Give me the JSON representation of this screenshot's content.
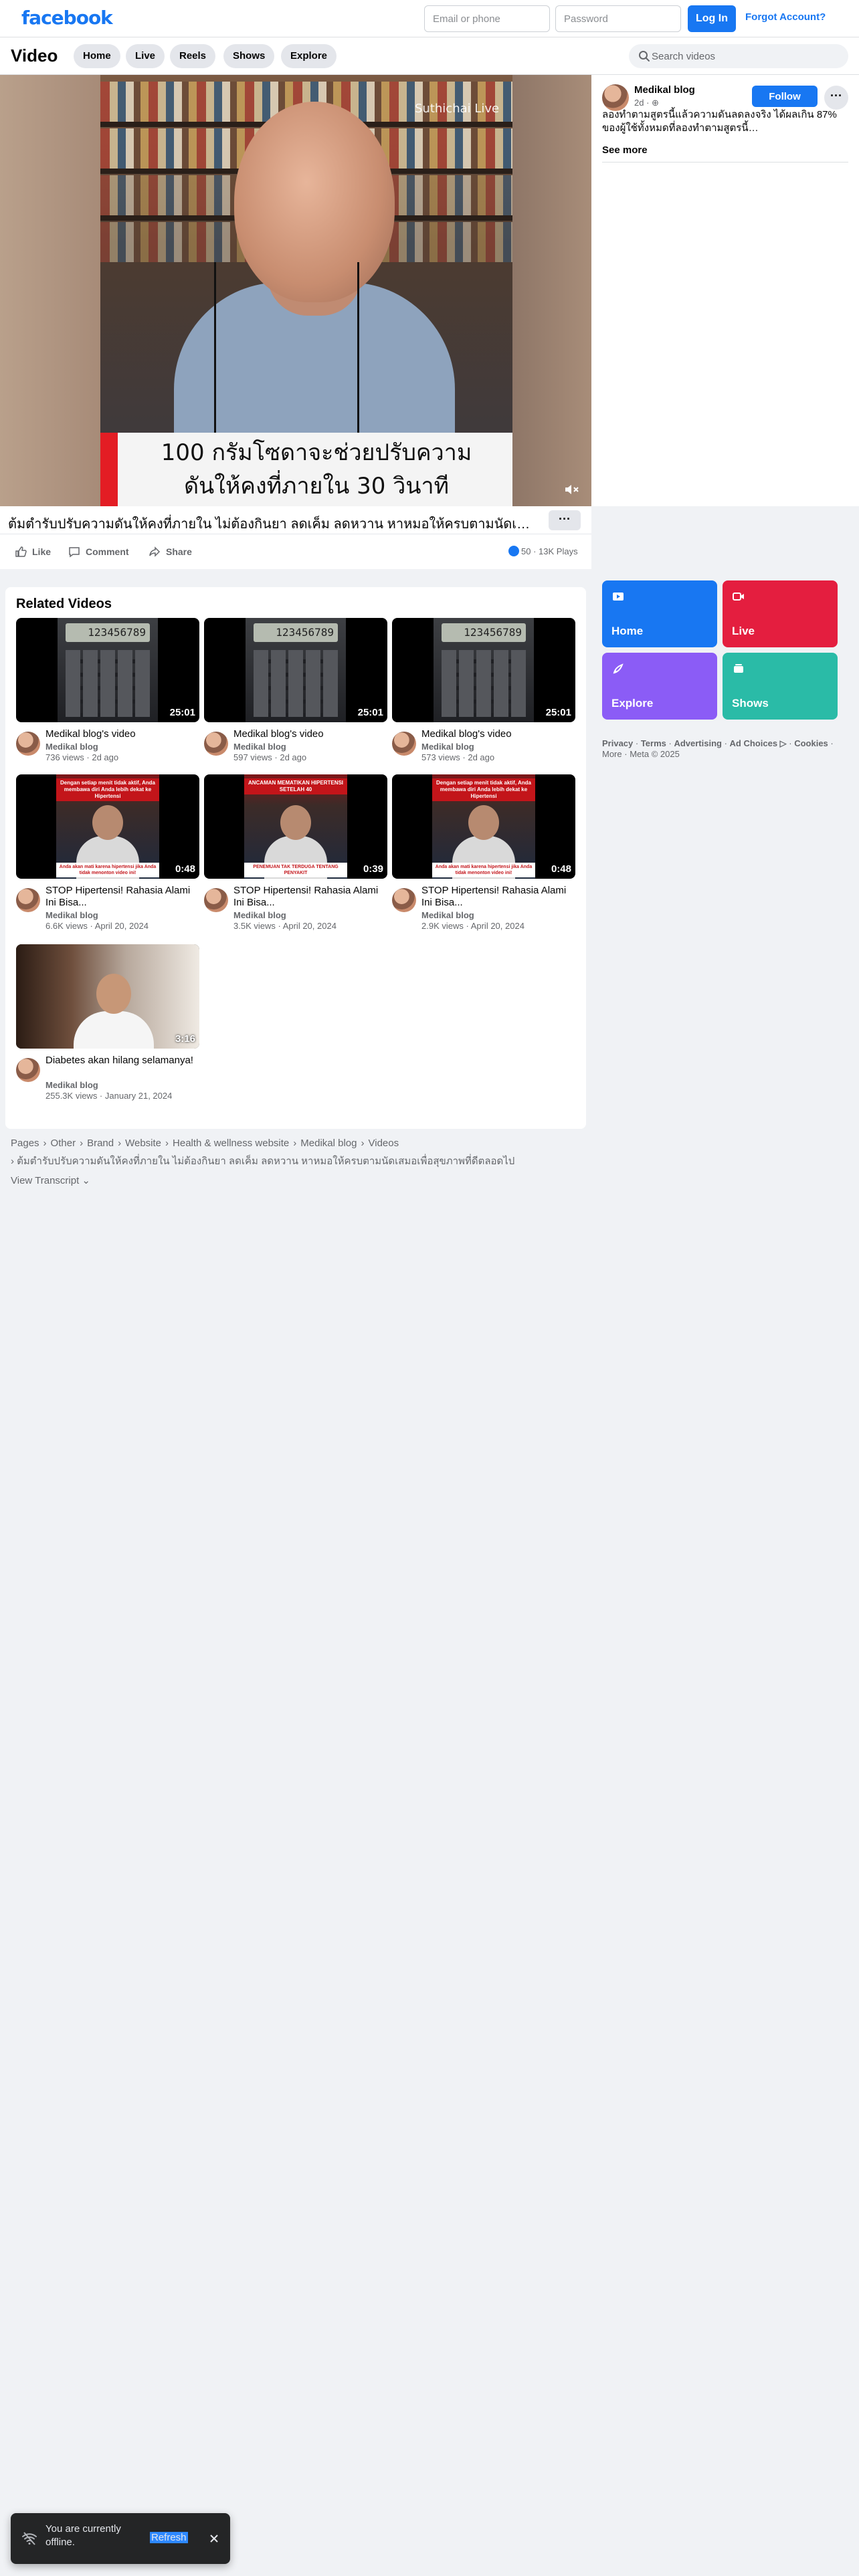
{
  "header": {
    "logo": "facebook",
    "email_placeholder": "Email or phone",
    "password_placeholder": "Password",
    "login_label": "Log In",
    "forgot_label": "Forgot Account?"
  },
  "video_nav": {
    "title": "Video",
    "tabs": [
      "Home",
      "Live",
      "Reels",
      "Shows",
      "Explore"
    ],
    "search_placeholder": "Search videos"
  },
  "player": {
    "watermark": "Suthichai Live",
    "caption_line1": "100 กรัมโซดาจะช่วยปรับความ",
    "caption_line2": "ดันให้คงที่ภายใน 30 วินาที",
    "title": "ต้มตำรับปรับความดันให้คงที่ภายใน ไม่ต้องกินยา ลดเค็ม ลดหวาน หาหมอให้ครบตามนัดเสมอเพื่อสุขภาพที่ดี…",
    "more_label": "···",
    "actions": [
      "Like",
      "Comment",
      "Share"
    ],
    "reaction_count": "50",
    "plays": "13K Plays"
  },
  "info_card": {
    "name": "Medikal blog",
    "time": "2d · ⊕",
    "follow_label": "Follow",
    "text": "ลองทำตามสูตรนี้แล้วความดันลดลงจริง ได้ผลเกิน 87% ของผู้ใช้ทั้งหมดที่ลองทำตามสูตรนี้…",
    "see_more": "See more"
  },
  "related": {
    "title": "Related Videos",
    "videos": [
      {
        "title": "Medikal blog's video",
        "channel": "Medikal blog",
        "meta": "736 views · 2d ago",
        "duration": "25:01",
        "thumb": "calculator"
      },
      {
        "title": "Medikal blog's video",
        "channel": "Medikal blog",
        "meta": "597 views · 2d ago",
        "duration": "25:01",
        "thumb": "calculator"
      },
      {
        "title": "Medikal blog's video",
        "channel": "Medikal blog",
        "meta": "573 views · 2d ago",
        "duration": "25:01",
        "thumb": "calculator"
      },
      {
        "title": "STOP Hipertensi! Rahasia Alami Ini Bisa...",
        "channel": "Medikal blog",
        "meta": "6.6K views · April 20, 2024",
        "duration": "0:48",
        "thumb": "talk"
      },
      {
        "title": "STOP Hipertensi! Rahasia Alami Ini Bisa...",
        "channel": "Medikal blog",
        "meta": "3.5K views · April 20, 2024",
        "duration": "0:39",
        "thumb": "talk"
      },
      {
        "title": "STOP Hipertensi! Rahasia Alami Ini Bisa...",
        "channel": "Medikal blog",
        "meta": "2.9K views · April 20, 2024",
        "duration": "0:48",
        "thumb": "talk"
      },
      {
        "title": "Diabetes akan hilang selamanya!",
        "channel": "Medikal blog",
        "meta": "255.3K views · January 21, 2024",
        "duration": "3:16",
        "thumb": "doctor"
      }
    ],
    "calc_screen": "123456789",
    "talk_banner_a": "Dengan setiap menit tidak aktif, Anda membawa diri Anda lebih dekat ke Hipertensi",
    "talk_banner_b": "ANCAMAN MEMATIKAN HIPERTENSI SETELAH 40",
    "talk_bottom_a": "Anda akan mati karena hipertensi jika Anda tidak menonton video ini!",
    "talk_bottom_b": "PENEMUAN TAK TERDUGA TENTANG PENYAKIT"
  },
  "tiles": [
    {
      "label": "Home",
      "color": "#1877f2",
      "icon": "video-icon"
    },
    {
      "label": "Live",
      "color": "#e41e3f",
      "icon": "live-icon"
    },
    {
      "label": "Explore",
      "color": "#8b5cf6",
      "icon": "rocket-icon"
    },
    {
      "label": "Shows",
      "color": "#2abba7",
      "icon": "shows-icon"
    }
  ],
  "footer": {
    "links": [
      "Privacy",
      "Terms",
      "Advertising",
      "Ad Choices ▷",
      "Cookies",
      "More",
      "Meta © 2025"
    ]
  },
  "breadcrumbs": {
    "items": [
      "Pages",
      "Other",
      "Brand",
      "Website",
      "Health & wellness website",
      "Medikal blog",
      "Videos"
    ],
    "current": "ต้มตำรับปรับความดันให้คงที่ภายใน ไม่ต้องกินยา ลดเค็ม ลดหวาน หาหมอให้ครบตามนัดเสมอเพื่อสุขภาพที่ดีตลอดไป",
    "transcript": "View Transcript ⌄"
  },
  "toast": {
    "text": "You are currently offline.",
    "refresh": "Refresh"
  }
}
